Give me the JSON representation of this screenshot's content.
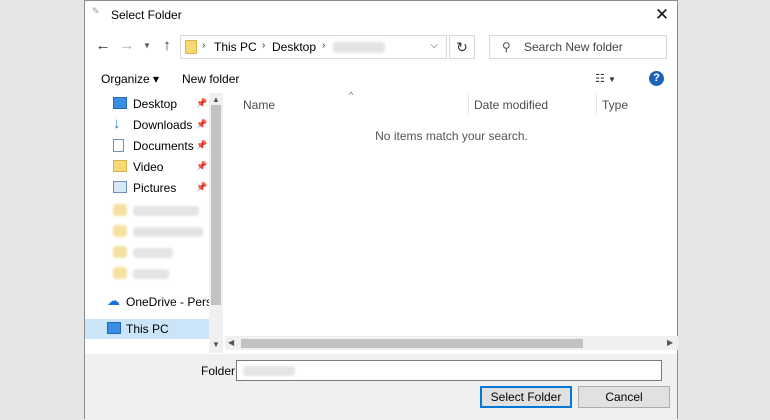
{
  "window": {
    "title": "Select Folder"
  },
  "nav": {
    "breadcrumbs": [
      "This PC",
      "Desktop"
    ],
    "search_placeholder": "Search New folder"
  },
  "toolbar": {
    "organize": "Organize ▾",
    "new_folder": "New folder"
  },
  "sidebar": {
    "items": [
      {
        "label": "Desktop",
        "icon": "desktop-icon",
        "pinned": true
      },
      {
        "label": "Downloads",
        "icon": "download-icon",
        "pinned": true
      },
      {
        "label": "Documents",
        "icon": "documents-icon",
        "pinned": true
      },
      {
        "label": "Video",
        "icon": "folder-icon",
        "pinned": true
      },
      {
        "label": "Pictures",
        "icon": "pictures-icon",
        "pinned": true
      }
    ],
    "onedrive": "OneDrive - Persor",
    "thispc": "This PC"
  },
  "columns": {
    "name": "Name",
    "date_modified": "Date modified",
    "type": "Type"
  },
  "content": {
    "empty_message": "No items match your search."
  },
  "footer": {
    "folder_label": "Folder:",
    "select_button": "Select Folder",
    "cancel_button": "Cancel"
  },
  "colors": {
    "accent": "#0078d7",
    "selection": "#cce4f7",
    "help": "#1e63b8",
    "folder": "#f8d775"
  }
}
